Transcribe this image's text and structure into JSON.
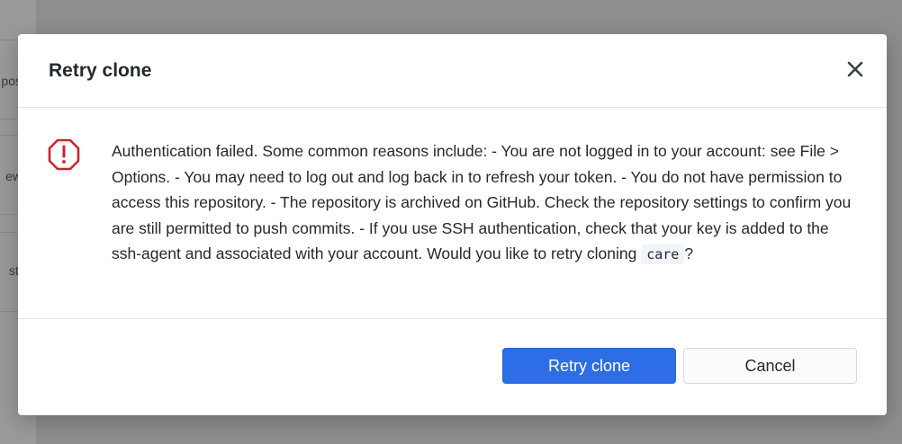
{
  "background": {
    "fragments": [
      "pos",
      "ew",
      "sti"
    ]
  },
  "dialog": {
    "title": "Retry clone",
    "close_icon": "close-icon",
    "alert_icon": "alert-octagon-icon",
    "message_text": "Authentication failed. Some common reasons include: - You are not logged in to your account: see File > Options. - You may need to log out and log back in to refresh your token. - You do not have permission to access this repository. - The repository is archived on GitHub. Check the repository settings to confirm you are still permitted to push commits. - If you use SSH authentication, check that your key is added to the ssh-agent and associated with your account. Would you like to retry cloning ",
    "repo_name": "care",
    "message_suffix": "?",
    "primary_button": "Retry clone",
    "secondary_button": "Cancel"
  },
  "colors": {
    "accent": "#2d6ee8",
    "alert": "#cf222e",
    "overlay": "#8e8e8e"
  }
}
